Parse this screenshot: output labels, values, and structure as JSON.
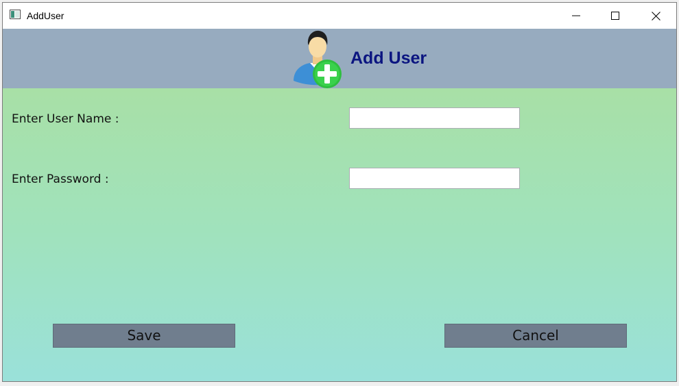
{
  "window": {
    "title": "AddUser",
    "controls": {
      "minimize_icon": "minimize-icon",
      "maximize_icon": "maximize-icon",
      "close_icon": "close-icon"
    }
  },
  "header": {
    "title": "Add User",
    "icon": "add-user-icon",
    "background_color": "#97abbf",
    "title_color": "#0b1580"
  },
  "form": {
    "username": {
      "label": "Enter User Name :",
      "value": "",
      "placeholder": ""
    },
    "password": {
      "label": "Enter Password :",
      "value": "",
      "placeholder": ""
    }
  },
  "buttons": {
    "save_label": "Save",
    "cancel_label": "Cancel",
    "color": "#707e8e"
  },
  "content": {
    "gradient_top": "#a8e0a6",
    "gradient_bottom": "#9ae1da"
  }
}
